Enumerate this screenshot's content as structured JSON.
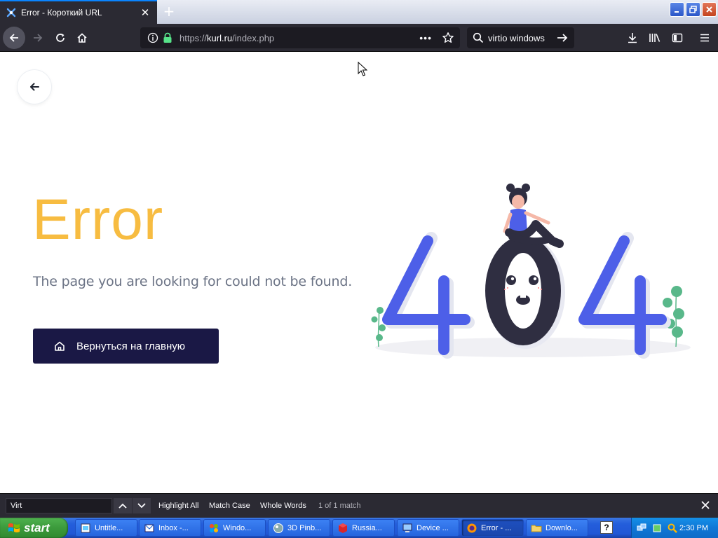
{
  "browser": {
    "tab_title": "Error - Короткий URL",
    "url_prefix": "https://",
    "url_domain": "kurl.ru",
    "url_path": "/index.php",
    "url_more": "•••",
    "search_value": "virtio windows"
  },
  "page": {
    "error_title": "Error",
    "error_message": "The page you are looking for could not be found.",
    "home_button": "Вернуться на главную",
    "illustration_text": "404"
  },
  "findbar": {
    "query": "Virt",
    "highlight_all": "Highlight All",
    "match_case": "Match Case",
    "whole_words": "Whole Words",
    "status": "1 of 1 match"
  },
  "taskbar": {
    "start_label": "start",
    "tasks": [
      {
        "label": "Untitle..."
      },
      {
        "label": "Inbox -..."
      },
      {
        "label": "Windo..."
      },
      {
        "label": "3D Pinb..."
      },
      {
        "label": "Russia..."
      },
      {
        "label": "Device ..."
      },
      {
        "label": "Error - ..."
      },
      {
        "label": "Downlo..."
      }
    ],
    "quick_launch": "?",
    "clock": "2:30 PM"
  },
  "colors": {
    "error_title": "#f7b731",
    "button_bg": "#1a1845",
    "illus_blue": "#4d5fe8",
    "illus_dark": "#2f2e41",
    "plant_green": "#59b88a"
  }
}
